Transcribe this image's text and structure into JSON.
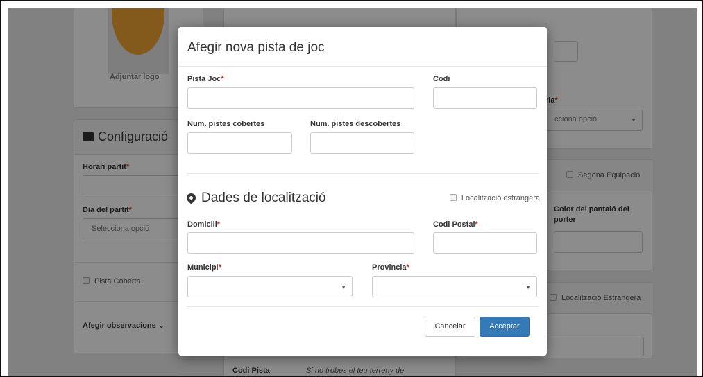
{
  "background": {
    "logo_label": "Adjuntar logo",
    "config_title": "Configuració",
    "horari_label": "Horari partit",
    "dia_label": "Dia del partit",
    "dia_placeholder": "Selecciona opció",
    "pista_coberta_label": "Pista Coberta",
    "observacions_label": "Afegir observacions",
    "right_select_label_tail": "ria",
    "right_select_value": "cciona opció",
    "segona_equipacio_label": "Segona Equipació",
    "color_pantalo_label": "Color del pantaló del porter",
    "localitzacio_estrangera_label": "Localització Estrangera",
    "codi_pista_label": "Codi Pista",
    "codi_pista_hint": "Si no trobes el teu terreny de"
  },
  "modal": {
    "title": "Afegir nova pista de joc",
    "fields": {
      "pista_joc_label": "Pista Joc",
      "codi_label": "Codi",
      "cobertes_label": "Num. pistes cobertes",
      "descobertes_label": "Num. pistes descobertes",
      "domicili_label": "Domicili",
      "codi_postal_label": "Codi Postal",
      "municipi_label": "Municipi",
      "provincia_label": "Provincia"
    },
    "location_section_title": "Dades de localització",
    "foreign_location_label": "Localització estrangera",
    "cancel_label": "Cancelar",
    "accept_label": "Acceptar"
  },
  "required_marker": "*",
  "colors": {
    "overlay": "#000000",
    "accent": "#337ab7",
    "required": "#c9302c",
    "logo_shield": "#f0a233"
  }
}
